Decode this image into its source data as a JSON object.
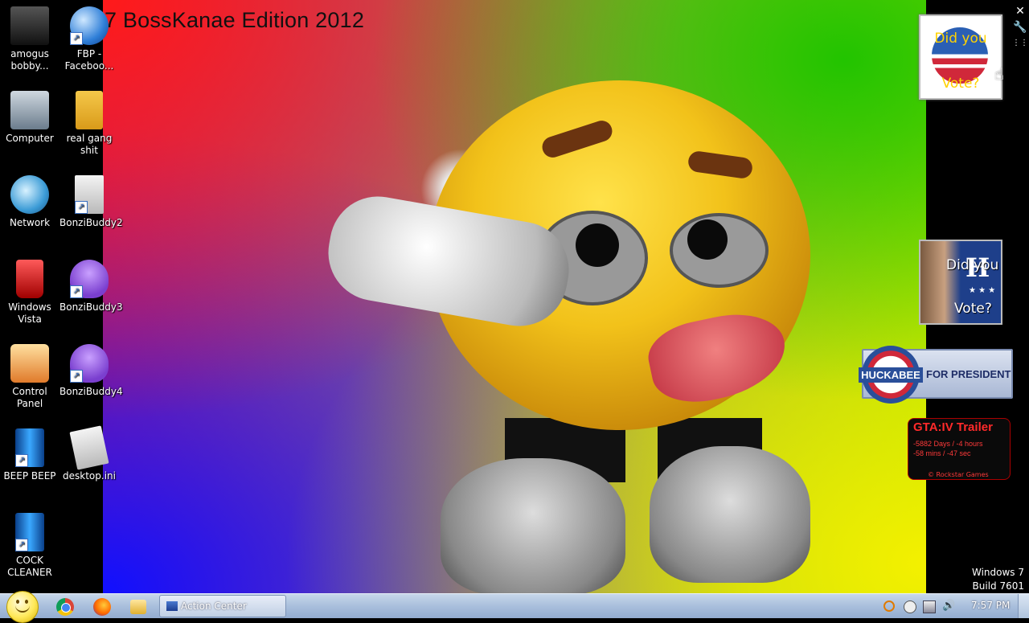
{
  "wallpaper": {
    "title": "7 BossKanae Edition 2012"
  },
  "desktop_icons": [
    {
      "label": "amogus\nbobby...",
      "icon": "folder-figure-icon"
    },
    {
      "label": "FBP -\nFaceboo...",
      "icon": "globe-icon"
    },
    {
      "label": "Computer",
      "icon": "computer-icon"
    },
    {
      "label": "real gang shit",
      "icon": "folder-icon"
    },
    {
      "label": "Network",
      "icon": "network-icon"
    },
    {
      "label": "BonziBuddy2",
      "icon": "document-icon"
    },
    {
      "label": "Windows\nVista",
      "icon": "recycle-bin-icon"
    },
    {
      "label": "BonziBuddy3",
      "icon": "bonzi-icon"
    },
    {
      "label": "Control\nPanel",
      "icon": "control-panel-icon"
    },
    {
      "label": "BonziBuddy4",
      "icon": "bonzi-icon"
    },
    {
      "label": "BEEP BEEP",
      "icon": "blue-file-icon"
    },
    {
      "label": "desktop.ini",
      "icon": "settings-file-icon"
    },
    {
      "label": "COCK\nCLEANER",
      "icon": "blue-file-icon"
    }
  ],
  "gadgets": {
    "obama": {
      "line1": "Did you",
      "line2": "Vote?"
    },
    "hillary": {
      "line1": "Did you",
      "line2": "Vote?",
      "letter": "H"
    },
    "huckabee": {
      "name": "HUCKABEE",
      "tagline": "FOR PRESIDENT"
    },
    "gta": {
      "title": "GTA:IV  Trailer",
      "line1": "-5882 Days / -4 hours",
      "line2": "-58 mins / -47 sec",
      "copyright": "©  Rockstar Games"
    }
  },
  "os_watermark": {
    "line1": "Windows 7",
    "line2": "Build 7601"
  },
  "taskbar": {
    "task_button_label": "Action Center",
    "clock": "7:57 PM"
  },
  "colors": {
    "taskbar": "#a9bfdc",
    "gta_red": "#ff2a2a",
    "huckabee_navy": "#1d2c66"
  }
}
